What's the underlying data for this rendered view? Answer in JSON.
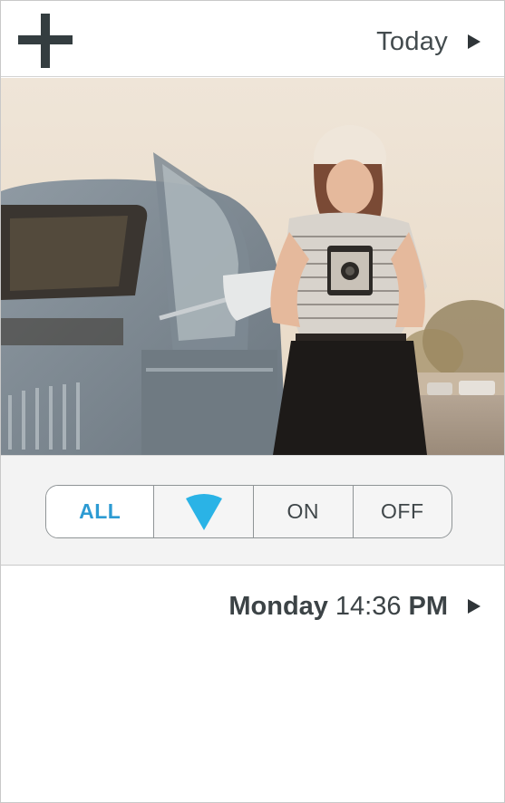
{
  "header": {
    "add_icon": "plus-icon",
    "date_label": "Today",
    "next_icon": "triangle-right-icon"
  },
  "photo": {
    "subject": "woman-with-vintage-camera-beside-car"
  },
  "filter": {
    "options": [
      {
        "label": "ALL",
        "selected": true
      },
      {
        "label": "",
        "icon": "drop-pin-icon"
      },
      {
        "label": "ON"
      },
      {
        "label": "OFF"
      }
    ],
    "accent_color": "#2d9bd3"
  },
  "entry": {
    "day": "Monday",
    "time": "14:36",
    "ampm": "PM",
    "next_icon": "triangle-right-icon"
  }
}
